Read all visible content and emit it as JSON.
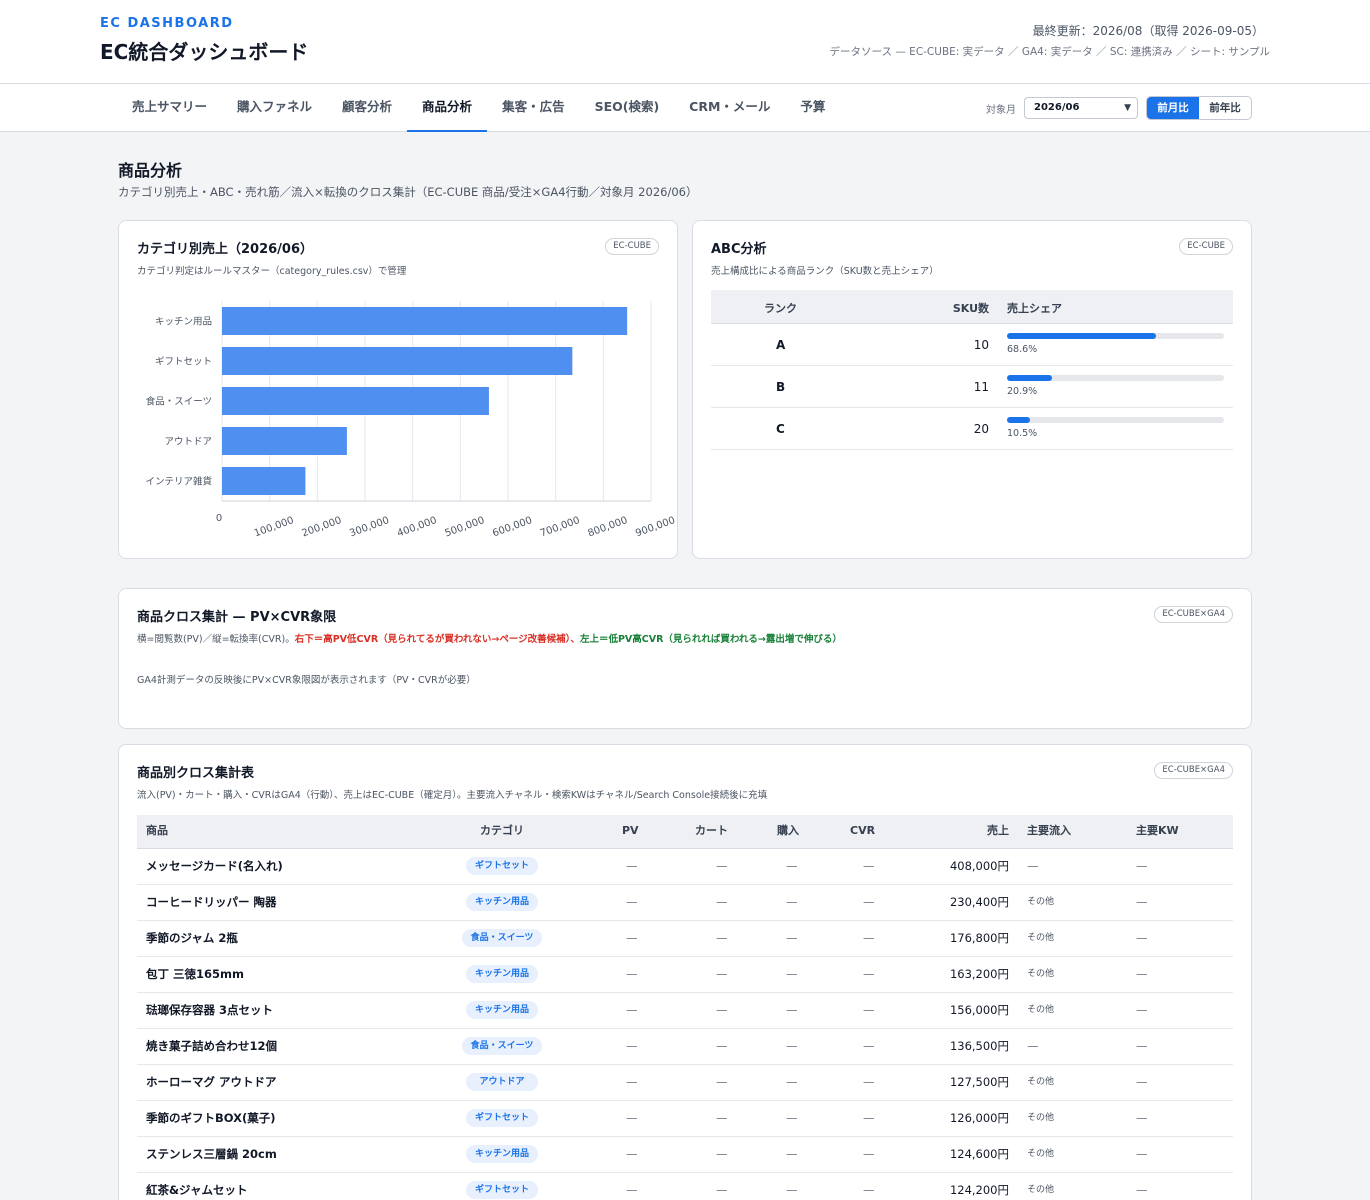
{
  "header": {
    "brand": "EC DASHBOARD",
    "title": "EC統合ダッシュボード",
    "last_updated": "最終更新：2026/08（取得 2026-09-05）",
    "data_source": "データソース — EC-CUBE: 実データ ／ GA4: 実データ ／ SC: 連携済み ／ シート: サンプル"
  },
  "nav": {
    "tabs": [
      {
        "label": "売上サマリー",
        "active": false
      },
      {
        "label": "購入ファネル",
        "active": false
      },
      {
        "label": "顧客分析",
        "active": false
      },
      {
        "label": "商品分析",
        "active": true
      },
      {
        "label": "集客・広告",
        "active": false
      },
      {
        "label": "SEO(検索)",
        "active": false
      },
      {
        "label": "CRM・メール",
        "active": false
      },
      {
        "label": "予算",
        "active": false
      }
    ],
    "period_label": "対象月",
    "period_value": "2026/06",
    "compare": [
      {
        "label": "前月比",
        "active": true
      },
      {
        "label": "前年比",
        "active": false
      }
    ]
  },
  "page": {
    "title": "商品分析",
    "subtitle": "カテゴリ別売上・ABC・売れ筋／流入×転換のクロス集計（EC-CUBE 商品/受注×GA4行動／対象月 2026/06）"
  },
  "category_card": {
    "title": "カテゴリ別売上（2026/06）",
    "source": "EC-CUBE",
    "subtitle": "カテゴリ判定はルールマスター（category_rules.csv）で管理"
  },
  "chart_data": {
    "type": "bar",
    "orientation": "horizontal",
    "title": "",
    "xlabel": "",
    "ylabel": "",
    "categories": [
      "キッチン用品",
      "ギフトセット",
      "食品・スイーツ",
      "アウトドア",
      "インテリア雑貨"
    ],
    "values": [
      850000,
      735000,
      560000,
      262000,
      175000
    ],
    "xlim": [
      0,
      900000
    ],
    "xticks": [
      0,
      100000,
      200000,
      300000,
      400000,
      500000,
      600000,
      700000,
      800000,
      900000
    ],
    "xtick_labels": [
      "0",
      "100,000",
      "200,000",
      "300,000",
      "400,000",
      "500,000",
      "600,000",
      "700,000",
      "800,000",
      "900,000"
    ],
    "grid": true,
    "legend": "none",
    "color": "#4f8ff0"
  },
  "abc_card": {
    "title": "ABC分析",
    "source": "EC-CUBE",
    "subtitle": "売上構成比による商品ランク（SKU数と売上シェア）",
    "headers": {
      "rank": "ランク",
      "sku": "SKU数",
      "share": "売上シェア"
    },
    "rows": [
      {
        "rank": "A",
        "sku": "10",
        "share": 68.6,
        "share_label": "68.6%"
      },
      {
        "rank": "B",
        "sku": "11",
        "share": 20.9,
        "share_label": "20.9%"
      },
      {
        "rank": "C",
        "sku": "20",
        "share": 10.5,
        "share_label": "10.5%"
      }
    ]
  },
  "quadrant_card": {
    "title": "商品クロス集計 — PV×CVR象限",
    "source": "EC-CUBE×GA4",
    "subtitle_prefix": "横=閲覧数(PV)／縦=転換率(CVR)。",
    "subtitle_red": "右下＝高PV低CVR（見られてるが買われない→ページ改善候補）",
    "subtitle_sep": "、",
    "subtitle_green": "左上＝低PV高CVR（見られれば買われる→露出増で伸びる）",
    "empty_message": "GA4計測データの反映後にPV×CVR象限図が表示されます（PV・CVRが必要）"
  },
  "product_card": {
    "title": "商品別クロス集計表",
    "source": "EC-CUBE×GA4",
    "subtitle": "流入(PV)・カート・購入・CVRはGA4（行動）、売上はEC-CUBE（確定月）。主要流入チャネル・検索KWはチャネル/Search Console接続後に充填",
    "headers": {
      "name": "商品",
      "category": "カテゴリ",
      "pv": "PV",
      "cart": "カート",
      "purchase": "購入",
      "cvr": "CVR",
      "sales": "売上",
      "channel": "主要流入",
      "keyword": "主要KW"
    },
    "rows": [
      {
        "name": "メッセージカード(名入れ)",
        "category": "ギフトセット",
        "pv": "—",
        "cart": "—",
        "purchase": "—",
        "cvr": "—",
        "sales": "408,000円",
        "channel": "—",
        "keyword": "—"
      },
      {
        "name": "コーヒードリッパー 陶器",
        "category": "キッチン用品",
        "pv": "—",
        "cart": "—",
        "purchase": "—",
        "cvr": "—",
        "sales": "230,400円",
        "channel": "その他",
        "keyword": "—"
      },
      {
        "name": "季節のジャム 2瓶",
        "category": "食品・スイーツ",
        "pv": "—",
        "cart": "—",
        "purchase": "—",
        "cvr": "—",
        "sales": "176,800円",
        "channel": "その他",
        "keyword": "—"
      },
      {
        "name": "包丁 三徳165mm",
        "category": "キッチン用品",
        "pv": "—",
        "cart": "—",
        "purchase": "—",
        "cvr": "—",
        "sales": "163,200円",
        "channel": "その他",
        "keyword": "—"
      },
      {
        "name": "琺瑯保存容器 3点セット",
        "category": "キッチン用品",
        "pv": "—",
        "cart": "—",
        "purchase": "—",
        "cvr": "—",
        "sales": "156,000円",
        "channel": "その他",
        "keyword": "—"
      },
      {
        "name": "焼き菓子詰め合わせ12個",
        "category": "食品・スイーツ",
        "pv": "—",
        "cart": "—",
        "purchase": "—",
        "cvr": "—",
        "sales": "136,500円",
        "channel": "—",
        "keyword": "—"
      },
      {
        "name": "ホーローマグ アウトドア",
        "category": "アウトドア",
        "pv": "—",
        "cart": "—",
        "purchase": "—",
        "cvr": "—",
        "sales": "127,500円",
        "channel": "その他",
        "keyword": "—"
      },
      {
        "name": "季節のギフトBOX(菓子)",
        "category": "ギフトセット",
        "pv": "—",
        "cart": "—",
        "purchase": "—",
        "cvr": "—",
        "sales": "126,000円",
        "channel": "その他",
        "keyword": "—"
      },
      {
        "name": "ステンレス三層鍋 20cm",
        "category": "キッチン用品",
        "pv": "—",
        "cart": "—",
        "purchase": "—",
        "cvr": "—",
        "sales": "124,600円",
        "channel": "その他",
        "keyword": "—"
      },
      {
        "name": "紅茶&ジャムセット",
        "category": "ギフトセット",
        "pv": "—",
        "cart": "—",
        "purchase": "—",
        "cvr": "—",
        "sales": "124,200円",
        "channel": "その他",
        "keyword": "—"
      }
    ]
  }
}
